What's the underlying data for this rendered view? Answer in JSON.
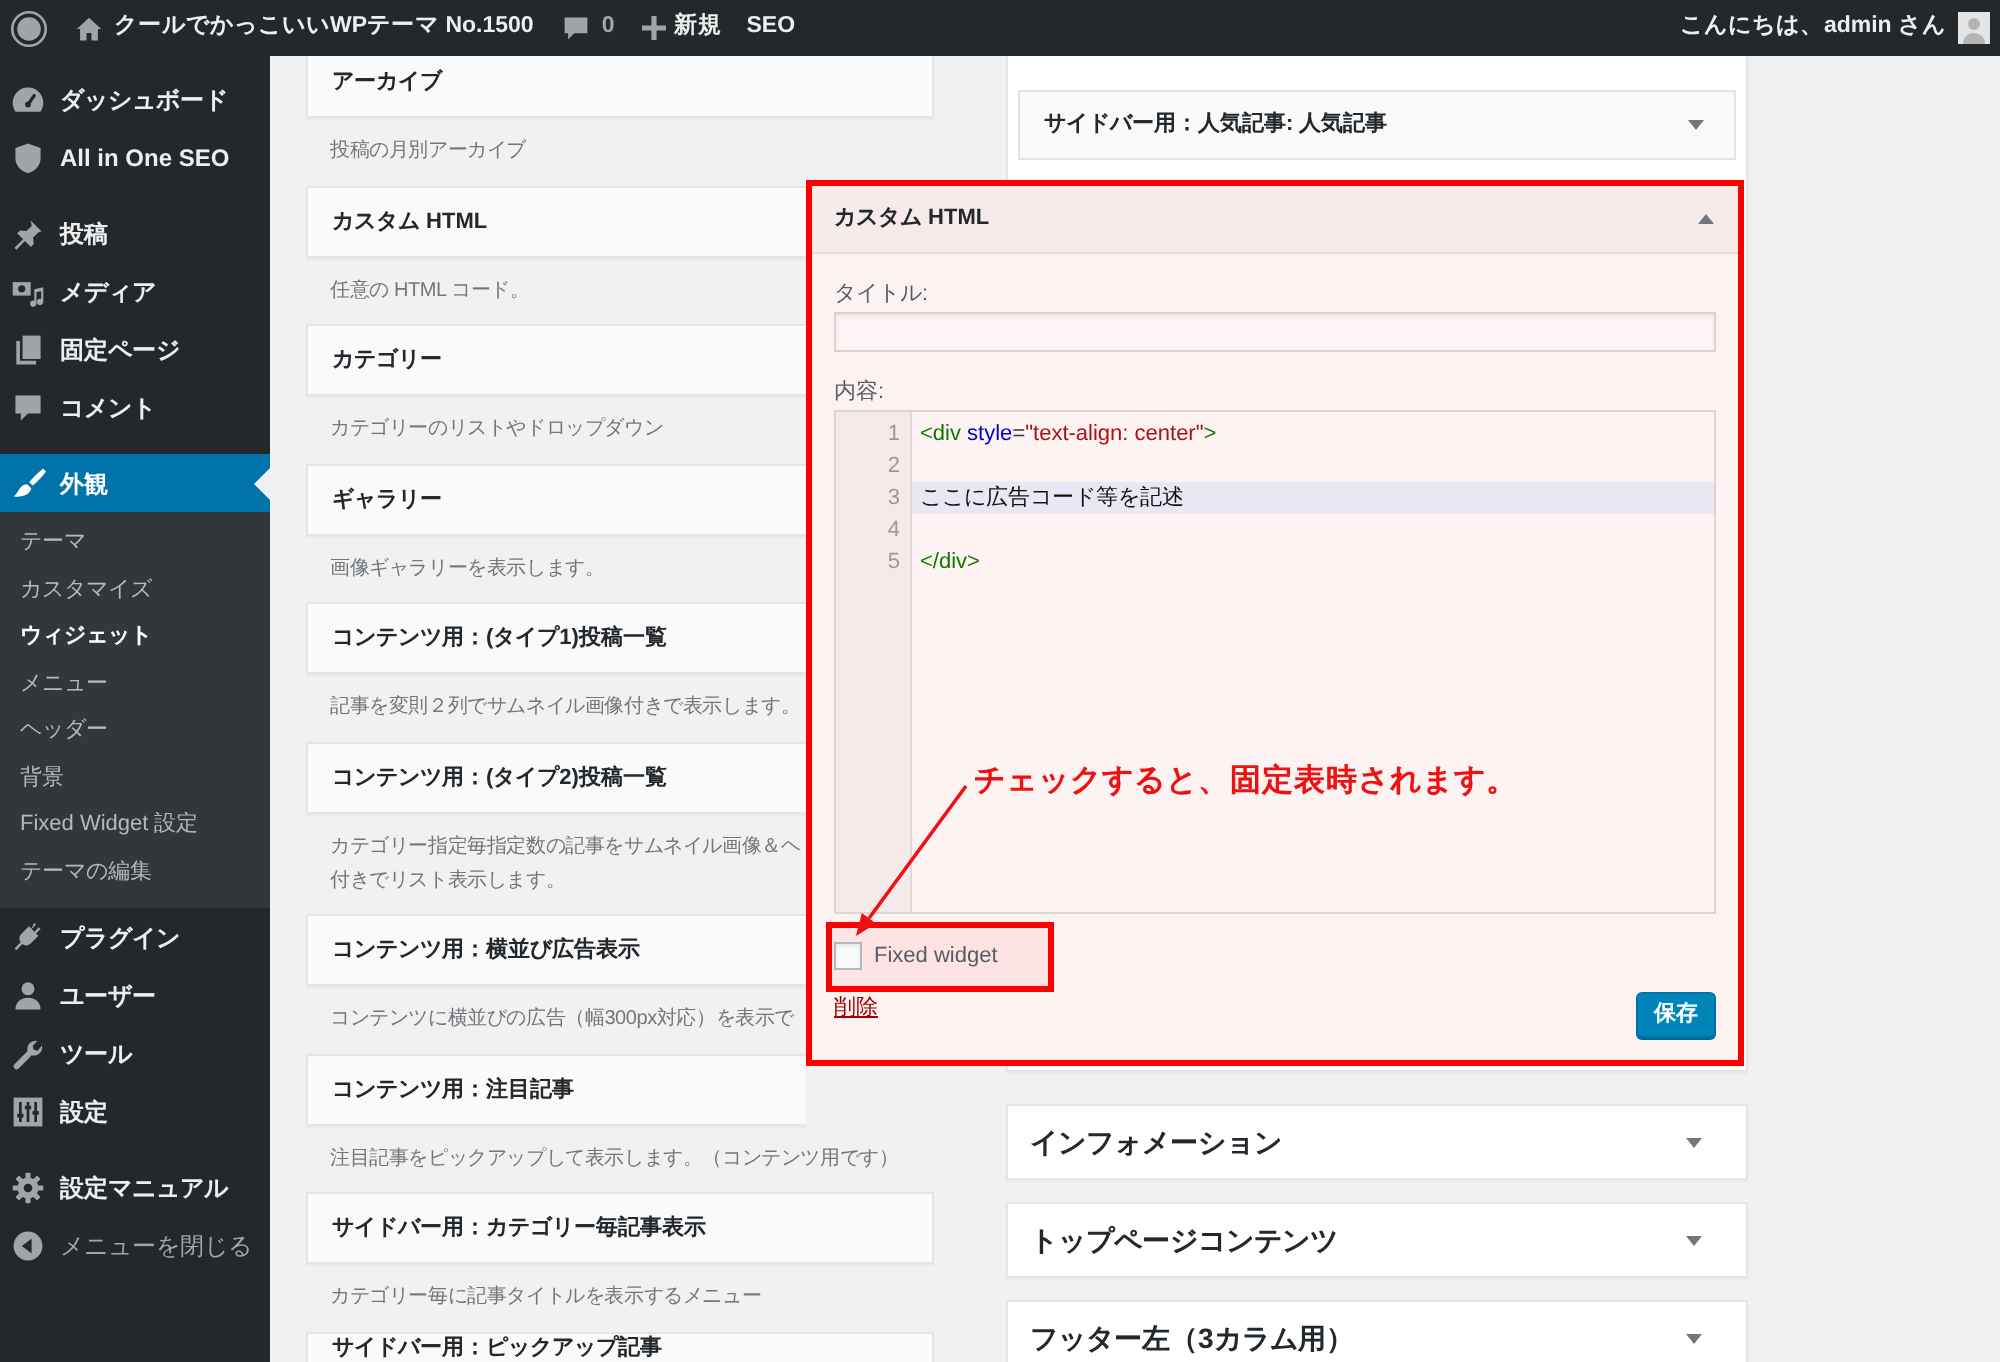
{
  "admin_bar": {
    "site_name": "クールでかっこいいWPテーマ No.1500",
    "comment_count": "0",
    "new_label": "新規",
    "seo_label": "SEO",
    "greeting": "こんにちは、admin さん"
  },
  "sidebar": {
    "groups": [
      {
        "items": [
          {
            "label": "ダッシュボード",
            "selected": false
          },
          {
            "label": "All in One SEO",
            "selected": false
          }
        ]
      },
      {
        "items": [
          {
            "label": "投稿",
            "selected": false
          },
          {
            "label": "メディア",
            "selected": false
          },
          {
            "label": "固定ページ",
            "selected": false
          },
          {
            "label": "コメント",
            "selected": false
          }
        ]
      },
      {
        "items": [
          {
            "label": "外観",
            "selected": true,
            "children": [
              {
                "label": "テーマ",
                "selected": false
              },
              {
                "label": "カスタマイズ",
                "selected": false
              },
              {
                "label": "ウィジェット",
                "selected": true
              },
              {
                "label": "メニュー",
                "selected": false
              },
              {
                "label": "ヘッダー",
                "selected": false
              },
              {
                "label": "背景",
                "selected": false
              },
              {
                "label": "Fixed Widget 設定",
                "selected": false
              },
              {
                "label": "テーマの編集",
                "selected": false
              }
            ]
          },
          {
            "label": "プラグイン",
            "selected": false
          },
          {
            "label": "ユーザー",
            "selected": false
          },
          {
            "label": "ツール",
            "selected": false
          },
          {
            "label": "設定",
            "selected": false
          }
        ]
      },
      {
        "items": [
          {
            "label": "設定マニュアル",
            "selected": false
          }
        ]
      }
    ],
    "collapse_label": "メニューを閉じる"
  },
  "available_widgets": [
    {
      "title": "アーカイブ",
      "description": [
        "投稿の月別アーカイブ"
      ]
    },
    {
      "title": "カスタム HTML",
      "description": [
        "任意の HTML コード。"
      ]
    },
    {
      "title": "カテゴリー",
      "description": [
        "カテゴリーのリストやドロップダウン"
      ]
    },
    {
      "title": "ギャラリー",
      "description": [
        "画像ギャラリーを表示します。"
      ]
    },
    {
      "title": "コンテンツ用：(タイプ1)投稿一覧",
      "description": [
        "記事を変則２列でサムネイル画像付きで表示します。"
      ]
    },
    {
      "title": "コンテンツ用：(タイプ2)投稿一覧",
      "description": [
        "カテゴリー指定毎指定数の記事をサムネイル画像＆ヘ",
        "付きでリスト表示します。"
      ]
    },
    {
      "title": "コンテンツ用：横並び広告表示",
      "description": [
        "コンテンツに横並びの広告（幅300px対応）を表示で"
      ]
    },
    {
      "title": "コンテンツ用：注目記事",
      "description": [
        "注目記事をピックアップして表示します。（コンテンツ用です）"
      ]
    },
    {
      "title": "サイドバー用：カテゴリー毎記事表示",
      "description": [
        "カテゴリー毎に記事タイトルを表示するメニュー"
      ]
    },
    {
      "title": "サイドバー用：ピックアップ記事"
    }
  ],
  "sidebar_area": {
    "widgets": [
      {
        "title": "サイドバー用：人気記事: 人気記事",
        "expanded": false
      }
    ]
  },
  "open_widget": {
    "title": "カスタム HTML",
    "expanded": true,
    "title_label": "タイトル:",
    "content_label": "内容:",
    "code_lines": [
      {
        "number": "1",
        "selected": false,
        "tokens": [
          {
            "kind": "tag",
            "text": "<div"
          },
          {
            "kind": "attribute",
            "text": " style"
          },
          {
            "kind": "operator",
            "text": "="
          },
          {
            "kind": "string",
            "text": "\"text-align: center\""
          },
          {
            "kind": "tag",
            "text": ">"
          }
        ]
      },
      {
        "number": "2",
        "selected": false
      },
      {
        "number": "3",
        "selected": true,
        "tokens": [
          {
            "kind": "text",
            "text": "ここに広告コード等を記述"
          }
        ]
      },
      {
        "number": "4",
        "selected": false
      },
      {
        "number": "5",
        "selected": false,
        "tokens": [
          {
            "kind": "tag",
            "text": "</div>"
          }
        ]
      }
    ],
    "fixed_widget": {
      "label": "Fixed widget",
      "checked": false
    },
    "delete_label": "削除",
    "save_label": "保存"
  },
  "widget_areas": [
    {
      "title": "インフォメーション",
      "expanded": false
    },
    {
      "title": "トップページコンテンツ",
      "expanded": false
    },
    {
      "title": "フッター左（3カラム用）",
      "expanded": false
    }
  ],
  "annotation": {
    "text": "チェックすると、固定表時されます。"
  }
}
